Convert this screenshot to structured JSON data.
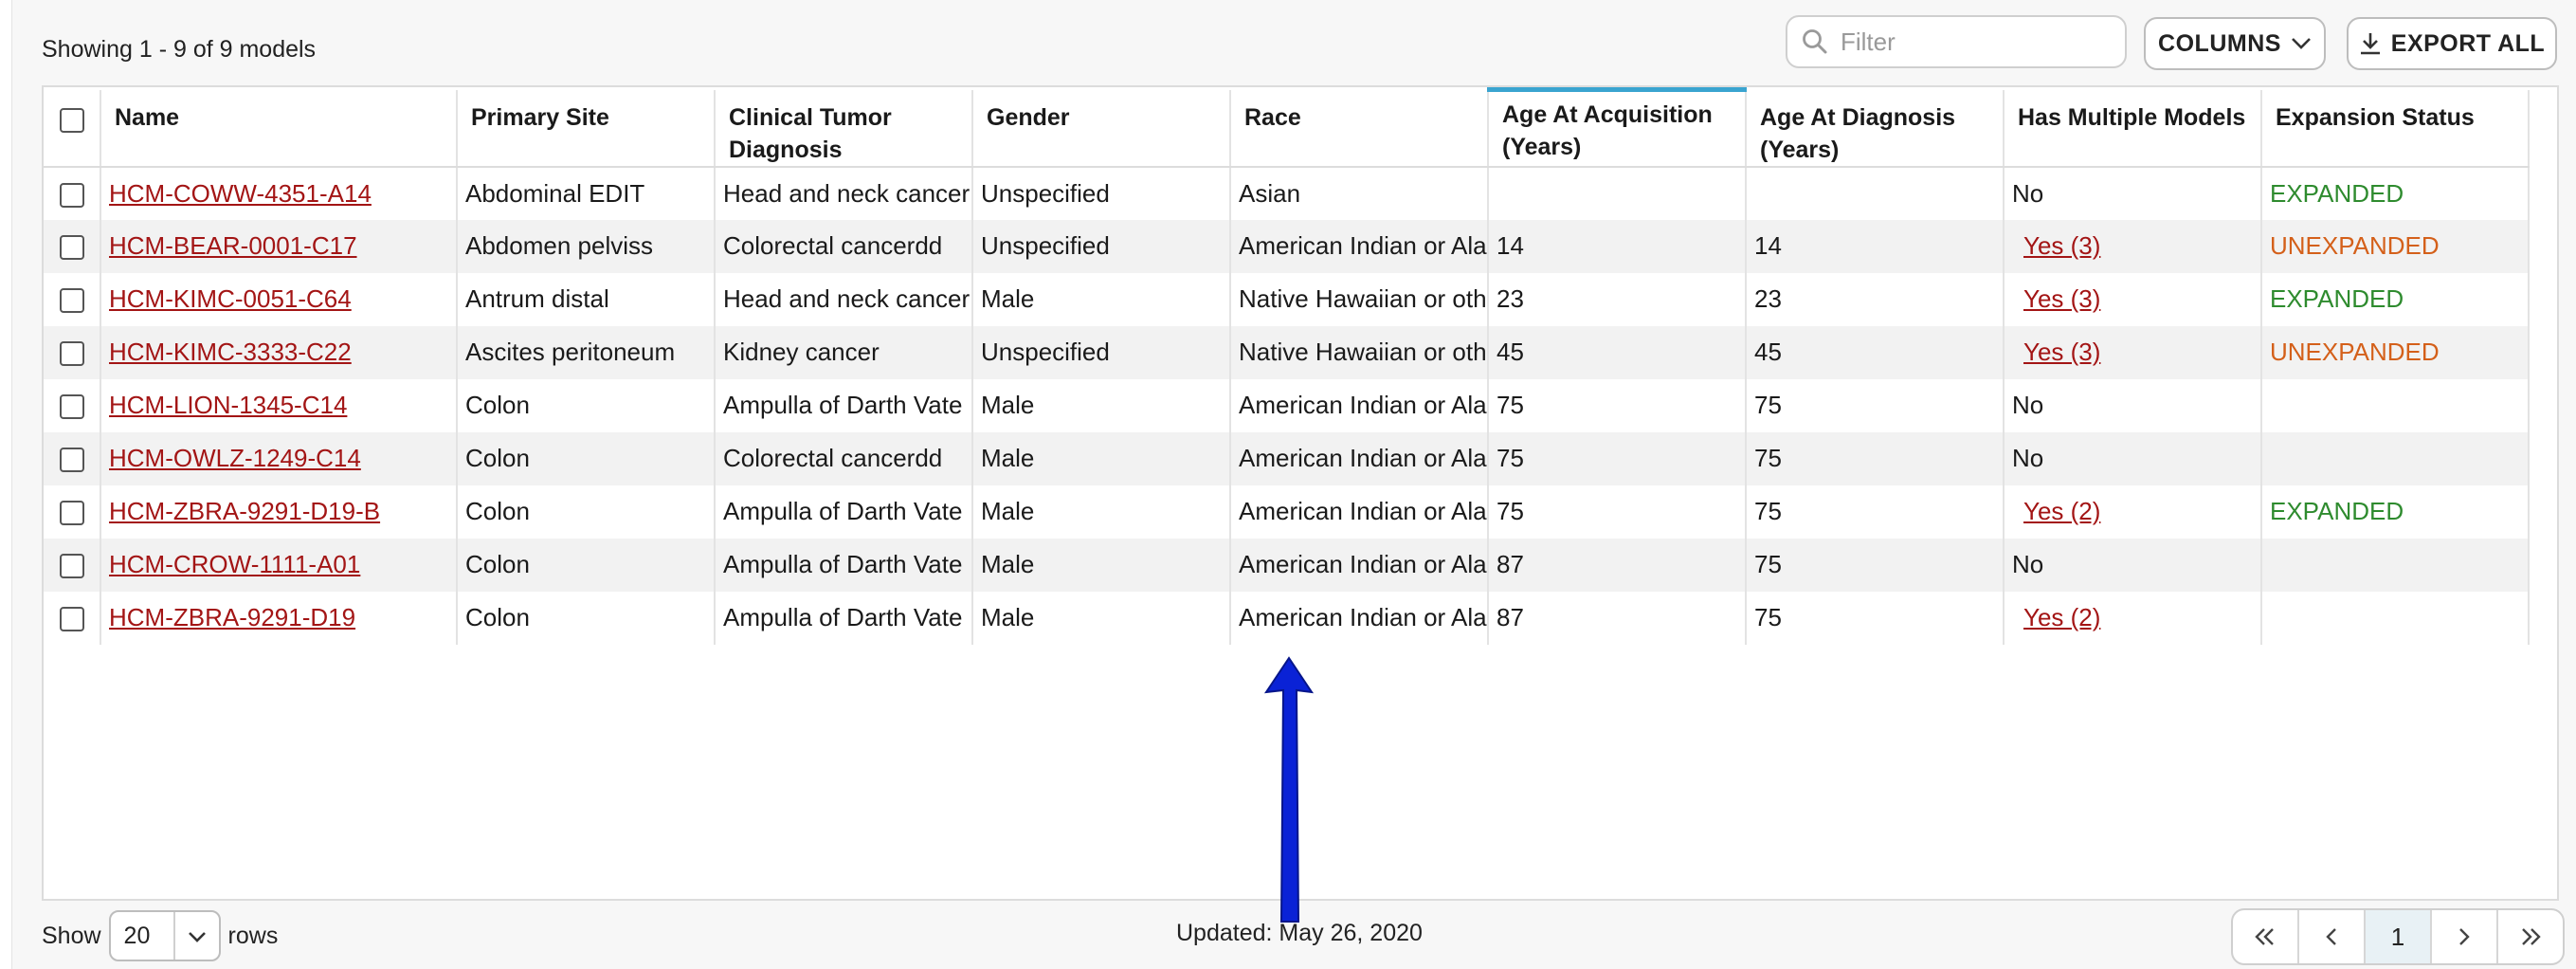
{
  "summary": {
    "showing_text": "Showing 1 - 9 of 9 models"
  },
  "toolbar": {
    "filter_placeholder": "Filter",
    "columns_label": "COLUMNS",
    "export_label": "EXPORT ALL"
  },
  "table": {
    "columns": [
      "Name",
      "Primary Site",
      "Clinical Tumor Diagnosis",
      "Gender",
      "Race",
      "Age At Acquisition (Years)",
      "Age At Diagnosis (Years)",
      "Has Multiple Models",
      "Expansion Status"
    ],
    "rows": [
      {
        "name": "HCM-COWW-4351-A14",
        "site": "Abdominal EDIT",
        "diagnosis": "Head and neck cancer",
        "gender": "Unspecified",
        "race": "Asian",
        "age_acq": "",
        "age_diag": "",
        "multiple": "No",
        "multiple_link": false,
        "status": "EXPANDED",
        "status_kind": "expanded"
      },
      {
        "name": "HCM-BEAR-0001-C17",
        "site": "Abdomen pelviss",
        "diagnosis": "Colorectal cancerdd",
        "gender": "Unspecified",
        "race": "American Indian or Ala",
        "age_acq": "14",
        "age_diag": "14",
        "multiple": "Yes (3)",
        "multiple_link": true,
        "status": "UNEXPANDED",
        "status_kind": "unexpanded"
      },
      {
        "name": "HCM-KIMC-0051-C64",
        "site": "Antrum distal",
        "diagnosis": "Head and neck cancer",
        "gender": "Male",
        "race": "Native Hawaiian or oth",
        "age_acq": "23",
        "age_diag": "23",
        "multiple": "Yes (3)",
        "multiple_link": true,
        "status": "EXPANDED",
        "status_kind": "expanded"
      },
      {
        "name": "HCM-KIMC-3333-C22",
        "site": "Ascites peritoneum",
        "diagnosis": "Kidney cancer",
        "gender": "Unspecified",
        "race": "Native Hawaiian or oth",
        "age_acq": "45",
        "age_diag": "45",
        "multiple": "Yes (3)",
        "multiple_link": true,
        "status": "UNEXPANDED",
        "status_kind": "unexpanded"
      },
      {
        "name": "HCM-LION-1345-C14",
        "site": "Colon",
        "diagnosis": "Ampulla of Darth Vate",
        "gender": "Male",
        "race": "American Indian or Ala",
        "age_acq": "75",
        "age_diag": "75",
        "multiple": "No",
        "multiple_link": false,
        "status": "",
        "status_kind": "none"
      },
      {
        "name": "HCM-OWLZ-1249-C14",
        "site": "Colon",
        "diagnosis": "Colorectal cancerdd",
        "gender": "Male",
        "race": "American Indian or Ala",
        "age_acq": "75",
        "age_diag": "75",
        "multiple": "No",
        "multiple_link": false,
        "status": "",
        "status_kind": "none"
      },
      {
        "name": "HCM-ZBRA-9291-D19-B",
        "site": "Colon",
        "diagnosis": "Ampulla of Darth Vate",
        "gender": "Male",
        "race": "American Indian or Ala",
        "age_acq": "75",
        "age_diag": "75",
        "multiple": "Yes (2)",
        "multiple_link": true,
        "status": "EXPANDED",
        "status_kind": "expanded"
      },
      {
        "name": "HCM-CROW-1111-A01",
        "site": "Colon",
        "diagnosis": "Ampulla of Darth Vate",
        "gender": "Male",
        "race": "American Indian or Ala",
        "age_acq": "87",
        "age_diag": "75",
        "multiple": "No",
        "multiple_link": false,
        "status": "",
        "status_kind": "none"
      },
      {
        "name": "HCM-ZBRA-9291-D19",
        "site": "Colon",
        "diagnosis": "Ampulla of Darth Vate",
        "gender": "Male",
        "race": "American Indian or Ala",
        "age_acq": "87",
        "age_diag": "75",
        "multiple": "Yes (2)",
        "multiple_link": true,
        "status": "",
        "status_kind": "none"
      }
    ]
  },
  "footer": {
    "show_label": "Show",
    "rows_value": "20",
    "rows_label": "rows",
    "updated_text": "Updated: May 26, 2020",
    "current_page": "1"
  },
  "colors": {
    "link": "#a31515",
    "expanded": "#2e8b2e",
    "unexpanded": "#d4601a",
    "sort_indicator": "#3aa4d0",
    "arrow": "#0a22d6"
  },
  "icons": {
    "filter": "search-icon",
    "columns": "chevron-down-icon",
    "export": "download-icon",
    "rows_select": "chevron-down-icon",
    "first_page": "double-chevron-left-icon",
    "prev_page": "chevron-left-icon",
    "next_page": "chevron-right-icon",
    "last_page": "double-chevron-right-icon",
    "annotation": "arrow-up-icon"
  }
}
